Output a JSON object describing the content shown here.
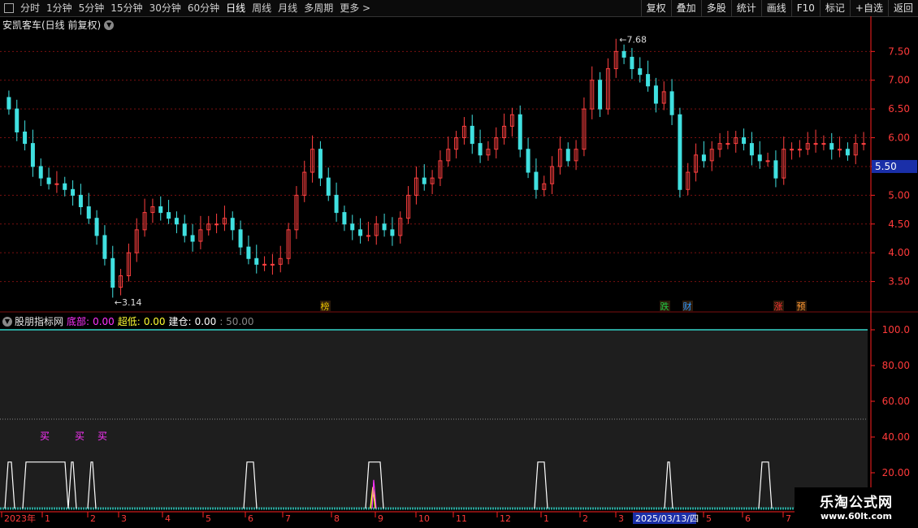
{
  "toolbar": {
    "periods": [
      "分时",
      "1分钟",
      "5分钟",
      "15分钟",
      "30分钟",
      "60分钟",
      "日线",
      "周线",
      "月线",
      "多周期",
      "更多 >"
    ],
    "active_period": "日线",
    "buttons": [
      "复权",
      "叠加",
      "多股",
      "统计",
      "画线",
      "F10",
      "标记",
      "+自选",
      "返回"
    ]
  },
  "main_chart": {
    "title": "安凯客车(日线 前复权)",
    "high_label": "7.68",
    "low_label": "3.14",
    "current_price": "5.50",
    "y_ticks": [
      "7.50",
      "7.00",
      "6.50",
      "6.00",
      "5.50",
      "5.00",
      "4.50",
      "4.00",
      "3.50"
    ],
    "event_markers": [
      {
        "text": "榜",
        "color": "#e8c000"
      },
      {
        "text": "跌",
        "color": "#22cc44"
      },
      {
        "text": "财",
        "color": "#3399ff"
      },
      {
        "text": "涨",
        "color": "#ff3333"
      },
      {
        "text": "预",
        "color": "#ff9933"
      }
    ],
    "colors": {
      "up": "#ff4040",
      "down": "#40e0e0",
      "grid": "#7a1010",
      "axis": "#ff2020"
    }
  },
  "indicator": {
    "name": "股朋指标网",
    "items": [
      {
        "label": "底部:",
        "value": "0.00",
        "color": "#ff33ff"
      },
      {
        "label": "超低:",
        "value": "0.00",
        "color": "#ffff33"
      },
      {
        "label": "建仓:",
        "value": "0.00",
        "color": "#ffffff"
      }
    ],
    "extra": ": 50.00",
    "y_ticks": [
      "100.0",
      "80.00",
      "60.00",
      "40.00",
      "20.00"
    ],
    "buy_label": "买",
    "colors": {
      "panel": "#1e1e1e",
      "border": "#2aa39a"
    }
  },
  "chart_data": [
    {
      "type": "candlestick",
      "title": "安凯客车(日线 前复权)",
      "ylim": [
        3.0,
        7.9
      ],
      "annotations": {
        "high": 7.68,
        "low": 3.14,
        "last": 5.5
      },
      "series_close": [
        6.5,
        6.1,
        5.9,
        5.5,
        5.3,
        5.2,
        5.2,
        5.1,
        5.0,
        4.8,
        4.6,
        4.3,
        3.9,
        3.4,
        3.6,
        4.0,
        4.4,
        4.7,
        4.8,
        4.7,
        4.6,
        4.5,
        4.3,
        4.2,
        4.4,
        4.5,
        4.5,
        4.6,
        4.4,
        4.1,
        3.9,
        3.8,
        3.8,
        3.8,
        3.9,
        4.4,
        5.0,
        5.4,
        5.8,
        5.3,
        5.0,
        4.7,
        4.5,
        4.4,
        4.3,
        4.3,
        4.5,
        4.4,
        4.3,
        4.6,
        5.0,
        5.3,
        5.2,
        5.3,
        5.6,
        5.8,
        6.0,
        6.2,
        5.9,
        5.7,
        5.8,
        6.0,
        6.2,
        6.4,
        5.8,
        5.4,
        5.1,
        5.2,
        5.5,
        5.8,
        5.6,
        5.8,
        6.5,
        7.0,
        6.5,
        7.2,
        7.5,
        7.4,
        7.2,
        7.1,
        6.9,
        6.6,
        6.8,
        6.4,
        5.1,
        5.4,
        5.7,
        5.6,
        5.8,
        5.9,
        5.9,
        6.0,
        5.9,
        5.7,
        5.6,
        5.6,
        5.3,
        5.8,
        5.8,
        5.8,
        5.9,
        5.9,
        5.9,
        5.8,
        5.8,
        5.7,
        5.9,
        5.9
      ],
      "x_ticks": [
        "2023年",
        "1",
        "2",
        "3",
        "4",
        "5",
        "6",
        "7",
        "8",
        "9",
        "10",
        "11",
        "12",
        "1",
        "2",
        "3",
        "2025/03/13/四",
        "5",
        "6",
        "7"
      ]
    },
    {
      "type": "line",
      "title": "股朋指标网",
      "ylim": [
        0,
        100
      ],
      "series": [
        {
          "name": "底部",
          "values": [
            0
          ]
        },
        {
          "name": "超低",
          "values": [
            0
          ]
        },
        {
          "name": "建仓",
          "values": [
            0
          ]
        }
      ],
      "reference_line": 50
    }
  ]
}
